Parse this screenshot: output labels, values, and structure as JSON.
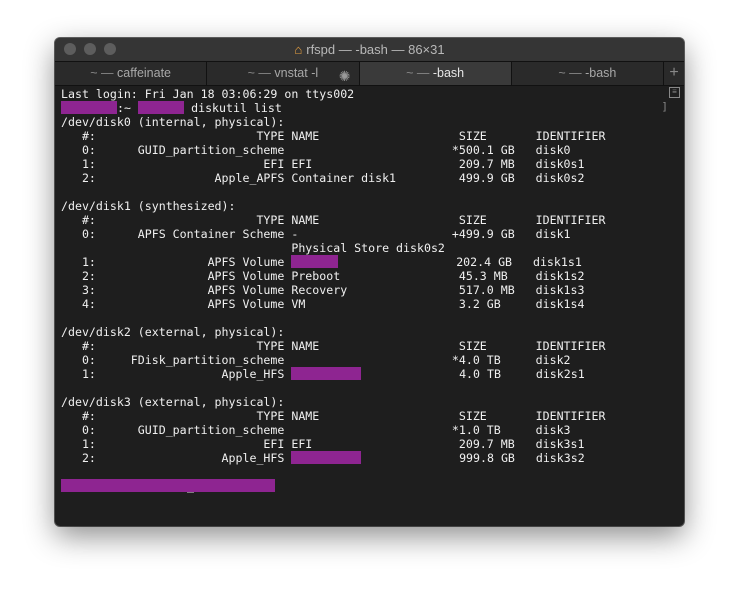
{
  "window": {
    "title": "rfspd — -bash — 86×31",
    "home_icon": "home-icon"
  },
  "tabs": [
    {
      "prefix": "~ —",
      "label": "caffeinate",
      "active": false
    },
    {
      "prefix": "~ —",
      "label": "vnstat -l",
      "active": false,
      "busy": true
    },
    {
      "prefix": "~ —",
      "label": "-bash",
      "active": true
    },
    {
      "prefix": "~ —",
      "label": "-bash",
      "active": false
    }
  ],
  "new_tab": "+",
  "terminal": {
    "redact_color": "#8e2591",
    "lines": [
      [
        {
          "t": "Last login: Fri Jan 18 03:06:29 on ttys002"
        }
      ],
      [
        {
          "r": 8
        },
        {
          "t": ":~ "
        },
        {
          "r": 6.6
        },
        {
          "t": " diskutil list"
        }
      ],
      [
        {
          "t": "/dev/disk0 (internal, physical):"
        }
      ],
      [
        {
          "t": "   #:                       TYPE NAME                    SIZE       IDENTIFIER"
        }
      ],
      [
        {
          "t": "   0:      GUID_partition_scheme                        *500.1 GB   disk0"
        }
      ],
      [
        {
          "t": "   1:                        EFI EFI                     209.7 MB   disk0s1"
        }
      ],
      [
        {
          "t": "   2:                 Apple_APFS Container disk1         499.9 GB   disk0s2"
        }
      ],
      [
        {
          "t": ""
        }
      ],
      [
        {
          "t": "/dev/disk1 (synthesized):"
        }
      ],
      [
        {
          "t": "   #:                       TYPE NAME                    SIZE       IDENTIFIER"
        }
      ],
      [
        {
          "t": "   0:      APFS Container Scheme -                      +499.9 GB   disk1"
        }
      ],
      [
        {
          "t": "                                 Physical Store disk0s2"
        }
      ],
      [
        {
          "t": "   1:                APFS Volume "
        },
        {
          "r": 6.6
        },
        {
          "t": "                 202.4 GB   disk1s1"
        }
      ],
      [
        {
          "t": "   2:                APFS Volume Preboot                 45.3 MB    disk1s2"
        }
      ],
      [
        {
          "t": "   3:                APFS Volume Recovery                517.0 MB   disk1s3"
        }
      ],
      [
        {
          "t": "   4:                APFS Volume VM                      3.2 GB     disk1s4"
        }
      ],
      [
        {
          "t": ""
        }
      ],
      [
        {
          "t": "/dev/disk2 (external, physical):"
        }
      ],
      [
        {
          "t": "   #:                       TYPE NAME                    SIZE       IDENTIFIER"
        }
      ],
      [
        {
          "t": "   0:     FDisk_partition_scheme                        *4.0 TB     disk2"
        }
      ],
      [
        {
          "t": "   1:                  Apple_HFS "
        },
        {
          "r": 10
        },
        {
          "t": "              4.0 TB     disk2s1"
        }
      ],
      [
        {
          "t": ""
        }
      ],
      [
        {
          "t": "/dev/disk3 (external, physical):"
        }
      ],
      [
        {
          "t": "   #:                       TYPE NAME                    SIZE       IDENTIFIER"
        }
      ],
      [
        {
          "t": "   0:      GUID_partition_scheme                        *1.0 TB     disk3"
        }
      ],
      [
        {
          "t": "   1:                        EFI EFI                     209.7 MB   disk3s1"
        }
      ],
      [
        {
          "t": "   2:                  Apple_HFS "
        },
        {
          "r": 10
        },
        {
          "t": "              999.8 GB   disk3s2"
        }
      ],
      [
        {
          "t": ""
        }
      ],
      [
        {
          "r": 30.5,
          "cursor": "_"
        }
      ]
    ]
  },
  "scrollback_marker": "]"
}
